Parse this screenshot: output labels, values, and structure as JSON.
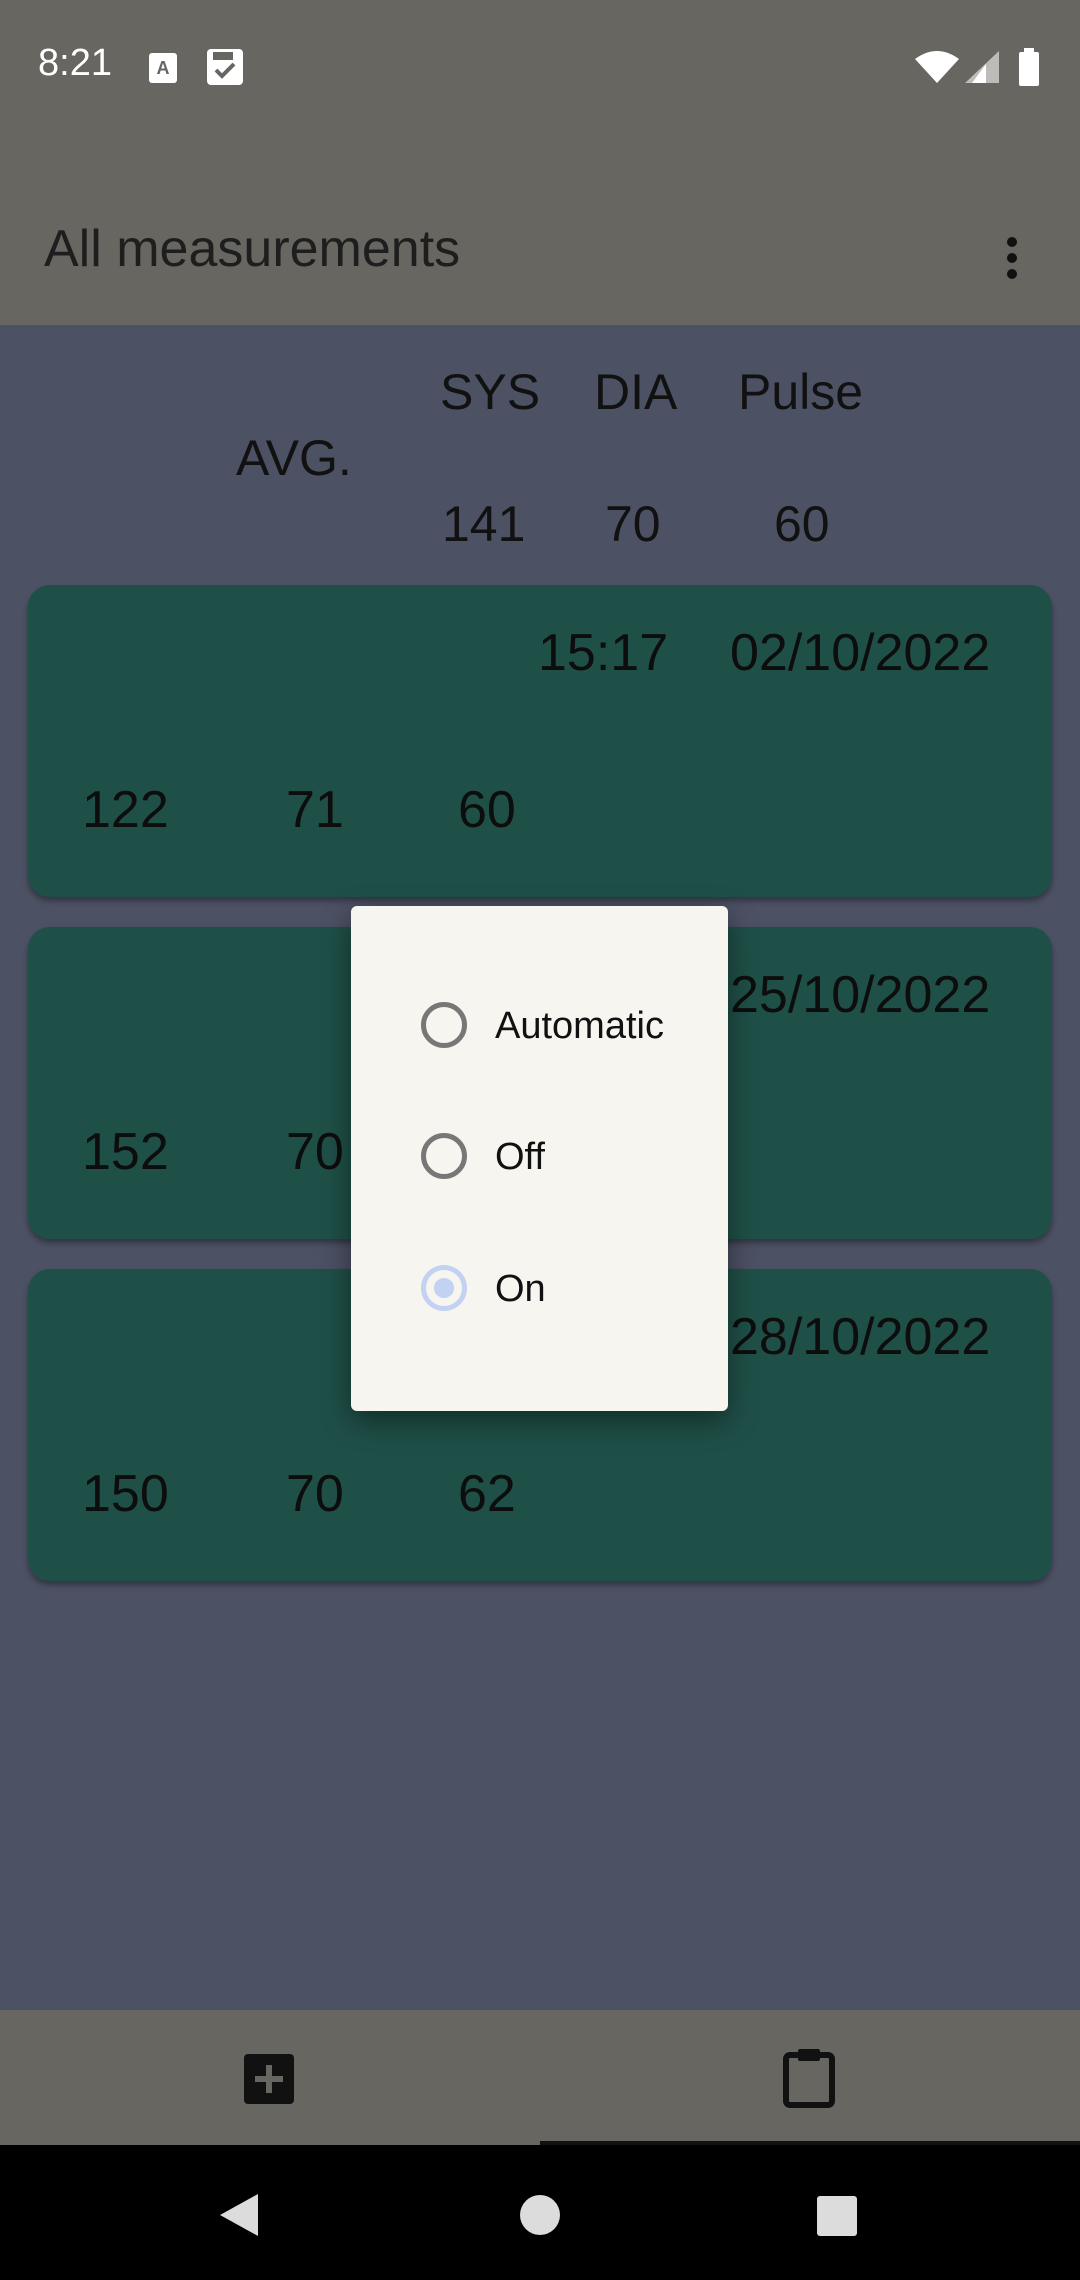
{
  "status_bar": {
    "time": "8:21"
  },
  "app_bar": {
    "title": "All measurements"
  },
  "averages": {
    "label": "AVG.",
    "sys_header": "SYS",
    "dia_header": "DIA",
    "pulse_header": "Pulse",
    "sys": "141",
    "dia": "70",
    "pulse": "60"
  },
  "measurements": [
    {
      "time": "15:17",
      "date": "02/10/2022",
      "sys": "122",
      "dia": "71",
      "pulse": "60"
    },
    {
      "date": "25/10/2022",
      "sys": "152",
      "dia": "70"
    },
    {
      "date": "28/10/2022",
      "sys": "150",
      "dia": "70",
      "pulse": "62"
    }
  ],
  "dialog": {
    "options": [
      "Automatic",
      "Off",
      "On"
    ],
    "selected": "On"
  }
}
